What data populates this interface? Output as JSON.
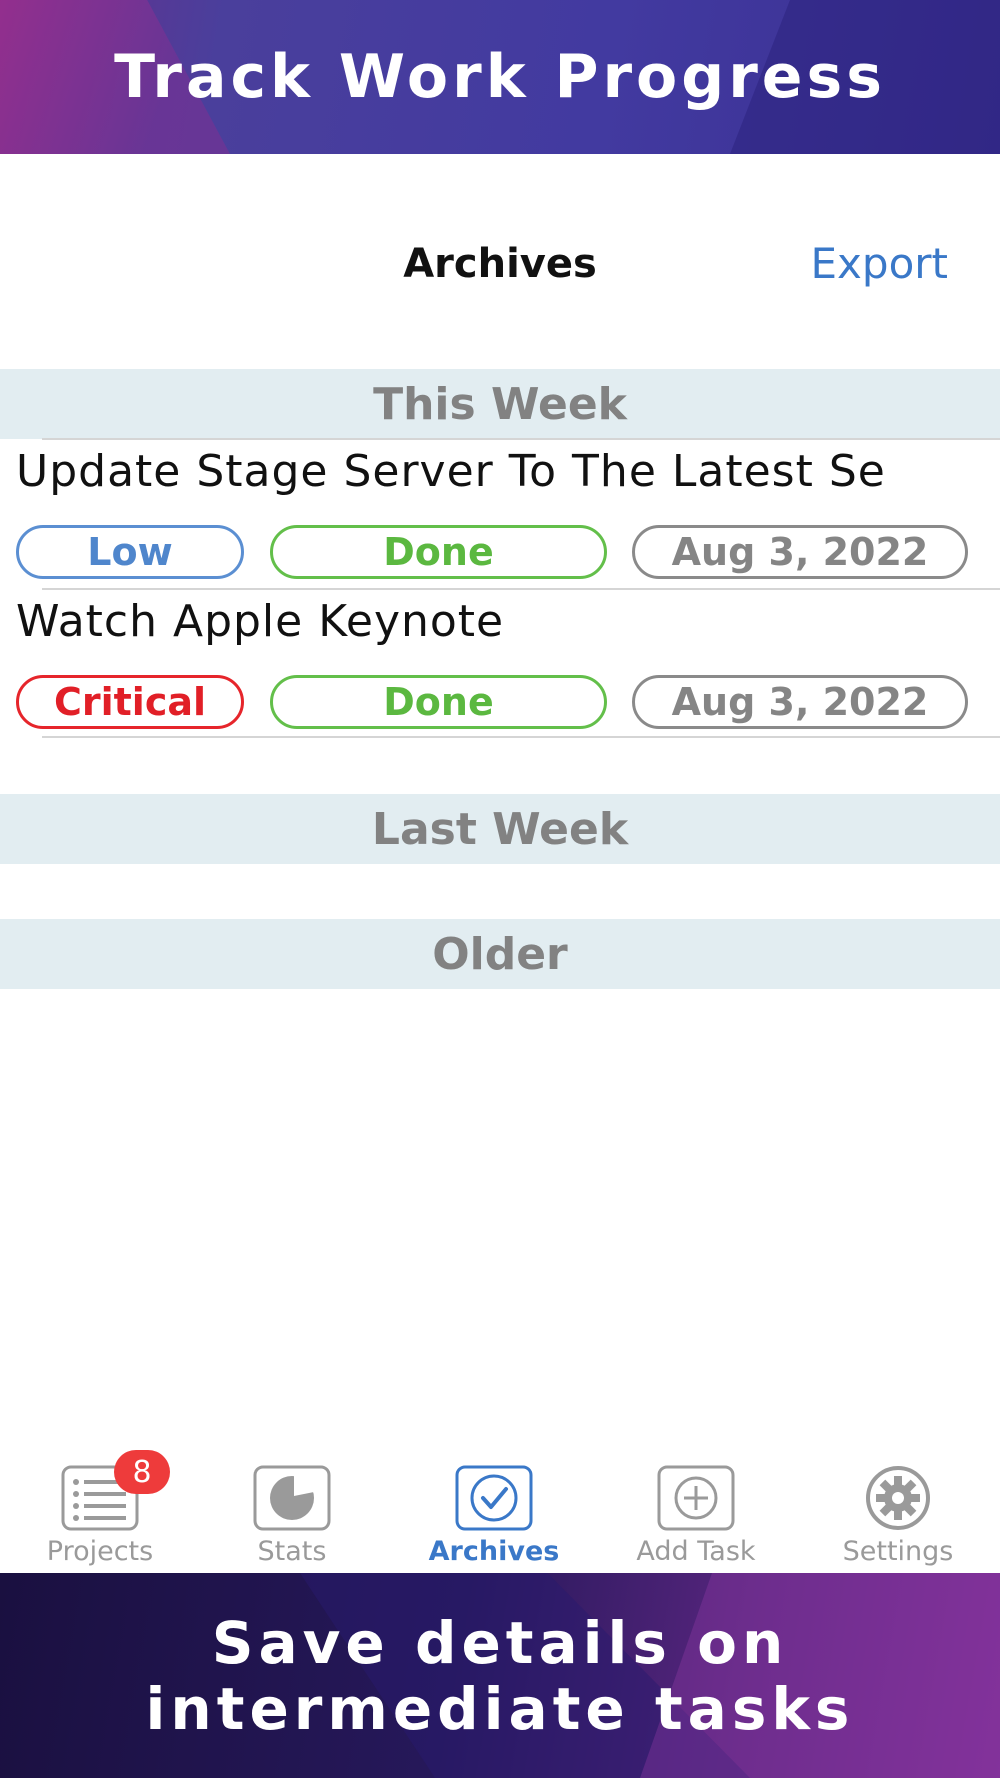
{
  "banner_top": {
    "text": "Track Work Progress"
  },
  "navbar": {
    "title": "Archives",
    "export_label": "Export"
  },
  "sections": {
    "this_week": "This Week",
    "last_week": "Last Week",
    "older": "Older"
  },
  "tasks": [
    {
      "title": "Update Stage Server To The Latest Se",
      "priority": "Low",
      "status": "Done",
      "date": "Aug 3, 2022"
    },
    {
      "title": "Watch Apple Keynote",
      "priority": "Critical",
      "status": "Done",
      "date": "Aug 3, 2022"
    }
  ],
  "tabbar": {
    "items": [
      {
        "label": "Projects",
        "icon": "list-icon",
        "badge": "8"
      },
      {
        "label": "Stats",
        "icon": "pie-chart-icon"
      },
      {
        "label": "Archives",
        "icon": "checkmark-icon",
        "active": true
      },
      {
        "label": "Add Task",
        "icon": "plus-icon"
      },
      {
        "label": "Settings",
        "icon": "gear-icon"
      }
    ]
  },
  "banner_bottom": {
    "line1": "Save details on",
    "line2": "intermediate tasks"
  },
  "colors": {
    "accent": "#3a78c8",
    "low": "#4f86cc",
    "critical": "#e11f27",
    "done": "#5bb840",
    "date": "#858585",
    "section_bg": "#e2edf1",
    "badge": "#ee3b3b"
  }
}
